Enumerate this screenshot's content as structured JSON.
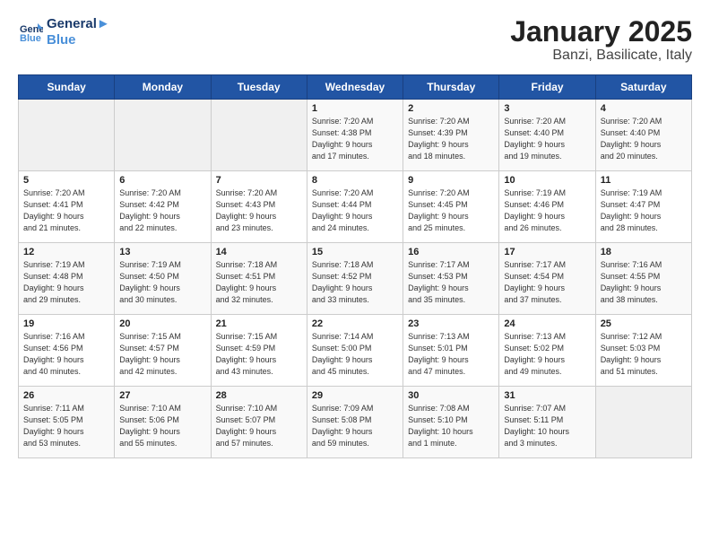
{
  "header": {
    "logo_line1": "General",
    "logo_line2": "Blue",
    "title": "January 2025",
    "subtitle": "Banzi, Basilicate, Italy"
  },
  "days_of_week": [
    "Sunday",
    "Monday",
    "Tuesday",
    "Wednesday",
    "Thursday",
    "Friday",
    "Saturday"
  ],
  "weeks": [
    [
      {
        "date": "",
        "info": ""
      },
      {
        "date": "",
        "info": ""
      },
      {
        "date": "",
        "info": ""
      },
      {
        "date": "1",
        "info": "Sunrise: 7:20 AM\nSunset: 4:38 PM\nDaylight: 9 hours\nand 17 minutes."
      },
      {
        "date": "2",
        "info": "Sunrise: 7:20 AM\nSunset: 4:39 PM\nDaylight: 9 hours\nand 18 minutes."
      },
      {
        "date": "3",
        "info": "Sunrise: 7:20 AM\nSunset: 4:40 PM\nDaylight: 9 hours\nand 19 minutes."
      },
      {
        "date": "4",
        "info": "Sunrise: 7:20 AM\nSunset: 4:40 PM\nDaylight: 9 hours\nand 20 minutes."
      }
    ],
    [
      {
        "date": "5",
        "info": "Sunrise: 7:20 AM\nSunset: 4:41 PM\nDaylight: 9 hours\nand 21 minutes."
      },
      {
        "date": "6",
        "info": "Sunrise: 7:20 AM\nSunset: 4:42 PM\nDaylight: 9 hours\nand 22 minutes."
      },
      {
        "date": "7",
        "info": "Sunrise: 7:20 AM\nSunset: 4:43 PM\nDaylight: 9 hours\nand 23 minutes."
      },
      {
        "date": "8",
        "info": "Sunrise: 7:20 AM\nSunset: 4:44 PM\nDaylight: 9 hours\nand 24 minutes."
      },
      {
        "date": "9",
        "info": "Sunrise: 7:20 AM\nSunset: 4:45 PM\nDaylight: 9 hours\nand 25 minutes."
      },
      {
        "date": "10",
        "info": "Sunrise: 7:19 AM\nSunset: 4:46 PM\nDaylight: 9 hours\nand 26 minutes."
      },
      {
        "date": "11",
        "info": "Sunrise: 7:19 AM\nSunset: 4:47 PM\nDaylight: 9 hours\nand 28 minutes."
      }
    ],
    [
      {
        "date": "12",
        "info": "Sunrise: 7:19 AM\nSunset: 4:48 PM\nDaylight: 9 hours\nand 29 minutes."
      },
      {
        "date": "13",
        "info": "Sunrise: 7:19 AM\nSunset: 4:50 PM\nDaylight: 9 hours\nand 30 minutes."
      },
      {
        "date": "14",
        "info": "Sunrise: 7:18 AM\nSunset: 4:51 PM\nDaylight: 9 hours\nand 32 minutes."
      },
      {
        "date": "15",
        "info": "Sunrise: 7:18 AM\nSunset: 4:52 PM\nDaylight: 9 hours\nand 33 minutes."
      },
      {
        "date": "16",
        "info": "Sunrise: 7:17 AM\nSunset: 4:53 PM\nDaylight: 9 hours\nand 35 minutes."
      },
      {
        "date": "17",
        "info": "Sunrise: 7:17 AM\nSunset: 4:54 PM\nDaylight: 9 hours\nand 37 minutes."
      },
      {
        "date": "18",
        "info": "Sunrise: 7:16 AM\nSunset: 4:55 PM\nDaylight: 9 hours\nand 38 minutes."
      }
    ],
    [
      {
        "date": "19",
        "info": "Sunrise: 7:16 AM\nSunset: 4:56 PM\nDaylight: 9 hours\nand 40 minutes."
      },
      {
        "date": "20",
        "info": "Sunrise: 7:15 AM\nSunset: 4:57 PM\nDaylight: 9 hours\nand 42 minutes."
      },
      {
        "date": "21",
        "info": "Sunrise: 7:15 AM\nSunset: 4:59 PM\nDaylight: 9 hours\nand 43 minutes."
      },
      {
        "date": "22",
        "info": "Sunrise: 7:14 AM\nSunset: 5:00 PM\nDaylight: 9 hours\nand 45 minutes."
      },
      {
        "date": "23",
        "info": "Sunrise: 7:13 AM\nSunset: 5:01 PM\nDaylight: 9 hours\nand 47 minutes."
      },
      {
        "date": "24",
        "info": "Sunrise: 7:13 AM\nSunset: 5:02 PM\nDaylight: 9 hours\nand 49 minutes."
      },
      {
        "date": "25",
        "info": "Sunrise: 7:12 AM\nSunset: 5:03 PM\nDaylight: 9 hours\nand 51 minutes."
      }
    ],
    [
      {
        "date": "26",
        "info": "Sunrise: 7:11 AM\nSunset: 5:05 PM\nDaylight: 9 hours\nand 53 minutes."
      },
      {
        "date": "27",
        "info": "Sunrise: 7:10 AM\nSunset: 5:06 PM\nDaylight: 9 hours\nand 55 minutes."
      },
      {
        "date": "28",
        "info": "Sunrise: 7:10 AM\nSunset: 5:07 PM\nDaylight: 9 hours\nand 57 minutes."
      },
      {
        "date": "29",
        "info": "Sunrise: 7:09 AM\nSunset: 5:08 PM\nDaylight: 9 hours\nand 59 minutes."
      },
      {
        "date": "30",
        "info": "Sunrise: 7:08 AM\nSunset: 5:10 PM\nDaylight: 10 hours\nand 1 minute."
      },
      {
        "date": "31",
        "info": "Sunrise: 7:07 AM\nSunset: 5:11 PM\nDaylight: 10 hours\nand 3 minutes."
      },
      {
        "date": "",
        "info": ""
      }
    ]
  ]
}
